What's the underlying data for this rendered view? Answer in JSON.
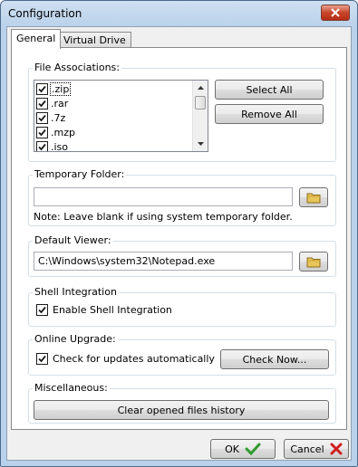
{
  "window": {
    "title": "Configuration"
  },
  "tabs": [
    {
      "label": "General",
      "active": true
    },
    {
      "label": "Virtual Drive",
      "active": false
    }
  ],
  "file_associations": {
    "label": "File Associations:",
    "items": [
      {
        "label": ".zip",
        "checked": true
      },
      {
        "label": ".rar",
        "checked": true
      },
      {
        "label": ".7z",
        "checked": true
      },
      {
        "label": ".mzp",
        "checked": true
      },
      {
        "label": ".iso",
        "checked": true
      }
    ],
    "select_all": "Select All",
    "remove_all": "Remove All"
  },
  "temporary_folder": {
    "label": "Temporary Folder:",
    "value": "",
    "note": "Note: Leave blank if using system temporary folder."
  },
  "default_viewer": {
    "label": "Default Viewer:",
    "value": "C:\\Windows\\system32\\Notepad.exe"
  },
  "shell_integration": {
    "label": "Shell Integration",
    "checkbox_label": "Enable Shell Integration",
    "checked": true
  },
  "online_upgrade": {
    "label": "Online Upgrade:",
    "checkbox_label": "Check for updates automatically",
    "checked": true,
    "check_now": "Check Now..."
  },
  "miscellaneous": {
    "label": "Miscellaneous:",
    "clear_history": "Clear opened files history"
  },
  "footer": {
    "ok": "OK",
    "cancel": "Cancel"
  },
  "colors": {
    "ok_check": "#2f9a2f",
    "cancel_x": "#d21e1e",
    "folder": "#e8c55a"
  }
}
